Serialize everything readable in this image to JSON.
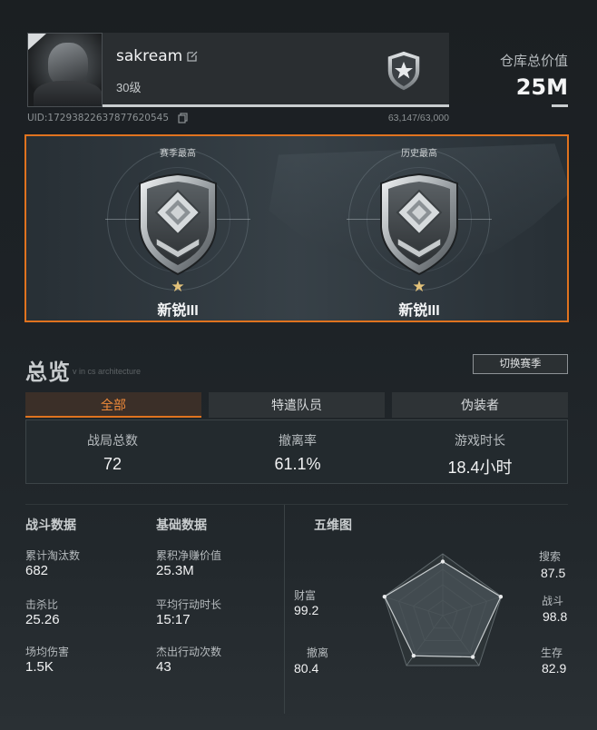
{
  "profile": {
    "username": "sakream",
    "level": "30级",
    "uid": "UID:17293822637877620545",
    "xp": "63,147/63,000"
  },
  "assets": {
    "label": "仓库总价值",
    "value": "25M"
  },
  "ranks": [
    {
      "caption": "赛季最高",
      "name": "新锐III",
      "stars": "★"
    },
    {
      "caption": "历史最高",
      "name": "新锐III",
      "stars": "★"
    }
  ],
  "overview": {
    "title": "总览",
    "subtitle": "v in cs architecture",
    "season_button": "切换赛季",
    "tabs": [
      {
        "label": "全部",
        "active": true
      },
      {
        "label": "特遣队员",
        "active": false
      },
      {
        "label": "伪装者",
        "active": false
      }
    ],
    "stats": [
      {
        "label": "战局总数",
        "value": "72"
      },
      {
        "label": "撤离率",
        "value": "61.1%"
      },
      {
        "label": "游戏时长",
        "value": "18.4小时"
      }
    ]
  },
  "combat": {
    "title": "战斗数据",
    "items": [
      {
        "label": "累计淘汰数",
        "value": "682"
      },
      {
        "label": "击杀比",
        "value": "25.26"
      },
      {
        "label": "场均伤害",
        "value": "1.5K"
      }
    ]
  },
  "basic": {
    "title": "基础数据",
    "items": [
      {
        "label": "累积净赚价值",
        "value": "25.3M"
      },
      {
        "label": "平均行动时长",
        "value": "15:17"
      },
      {
        "label": "杰出行动次数",
        "value": "43"
      }
    ]
  },
  "radar": {
    "title": "五维图",
    "axes": [
      {
        "label": "搜索",
        "value": 87.5
      },
      {
        "label": "战斗",
        "value": 98.8
      },
      {
        "label": "生存",
        "value": 82.9
      },
      {
        "label": "撤离",
        "value": 80.4
      },
      {
        "label": "财富",
        "value": 99.2
      }
    ]
  },
  "colors": {
    "accent": "#e0731f",
    "star": "#e3c27a"
  }
}
